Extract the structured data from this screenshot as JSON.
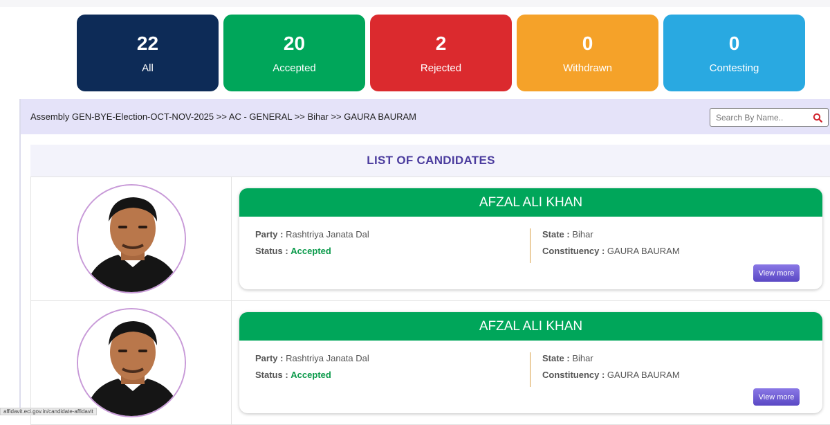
{
  "stats": [
    {
      "count": "22",
      "label": "All",
      "color": "#0d2b57"
    },
    {
      "count": "20",
      "label": "Accepted",
      "color": "#00a65a"
    },
    {
      "count": "2",
      "label": "Rejected",
      "color": "#db2a2e"
    },
    {
      "count": "0",
      "label": "Withdrawn",
      "color": "#f5a229"
    },
    {
      "count": "0",
      "label": "Contesting",
      "color": "#29a9e1"
    }
  ],
  "breadcrumb": "Assembly GEN-BYE-Election-OCT-NOV-2025 >> AC - GENERAL >> Bihar >> GAURA BAURAM",
  "search": {
    "placeholder": "Search By Name..",
    "icon": "search-icon"
  },
  "list_title": "LIST OF CANDIDATES",
  "candidates": [
    {
      "name": "AFZAL ALI KHAN",
      "party_label": "Party :",
      "party": "Rashtriya Janata Dal",
      "status_label": "Status :",
      "status": "Accepted",
      "state_label": "State :",
      "state": "Bihar",
      "constituency_label": "Constituency :",
      "constituency": "GAURA BAURAM",
      "button": "View more"
    },
    {
      "name": "AFZAL ALI KHAN",
      "party_label": "Party :",
      "party": "Rashtriya Janata Dal",
      "status_label": "Status :",
      "status": "Accepted",
      "state_label": "State :",
      "state": "Bihar",
      "constituency_label": "Constituency :",
      "constituency": "GAURA BAURAM",
      "button": "View more"
    }
  ],
  "status_url": "affidavit.eci.gov.in/candidate-affidavit"
}
